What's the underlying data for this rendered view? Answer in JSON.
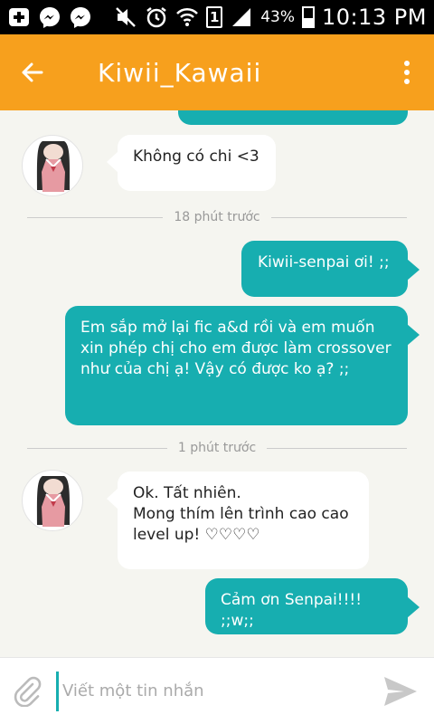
{
  "status_bar": {
    "icons": [
      "add-notification-icon",
      "messenger-icon",
      "messenger-icon",
      "muted-icon",
      "alarm-icon",
      "wifi-icon",
      "signal-icon"
    ],
    "sim_slot": "1",
    "battery_percent": "43%",
    "battery_level": 0.43,
    "time": "10:13 PM"
  },
  "app_bar": {
    "title": "Kiwii_Kawaii",
    "background_color": "#f7a01d"
  },
  "chat": {
    "messages": [
      {
        "direction": "in",
        "text": "Không có chi <3"
      },
      {
        "divider": "18 phút trước"
      },
      {
        "direction": "out",
        "text": "Kiwii-senpai ơi! ;;"
      },
      {
        "direction": "out",
        "text": "Em sắp mở lại fic a&d rồi và em muốn xin phép chị cho em được làm crossover như của chị ạ! Vậy có được ko ạ? ;;"
      },
      {
        "divider": "1 phút trước"
      },
      {
        "direction": "in",
        "line1": "Ok. Tất nhiên.",
        "line2": "Mong thím lên trình cao cao",
        "line3": "level up! ♡♡♡♡"
      },
      {
        "direction": "out",
        "text": "Cảm ơn Senpai!!!! ;;w;;"
      }
    ],
    "outgoing_color": "#17aeb0"
  },
  "input_bar": {
    "placeholder": "Viết một tin nhắn"
  }
}
